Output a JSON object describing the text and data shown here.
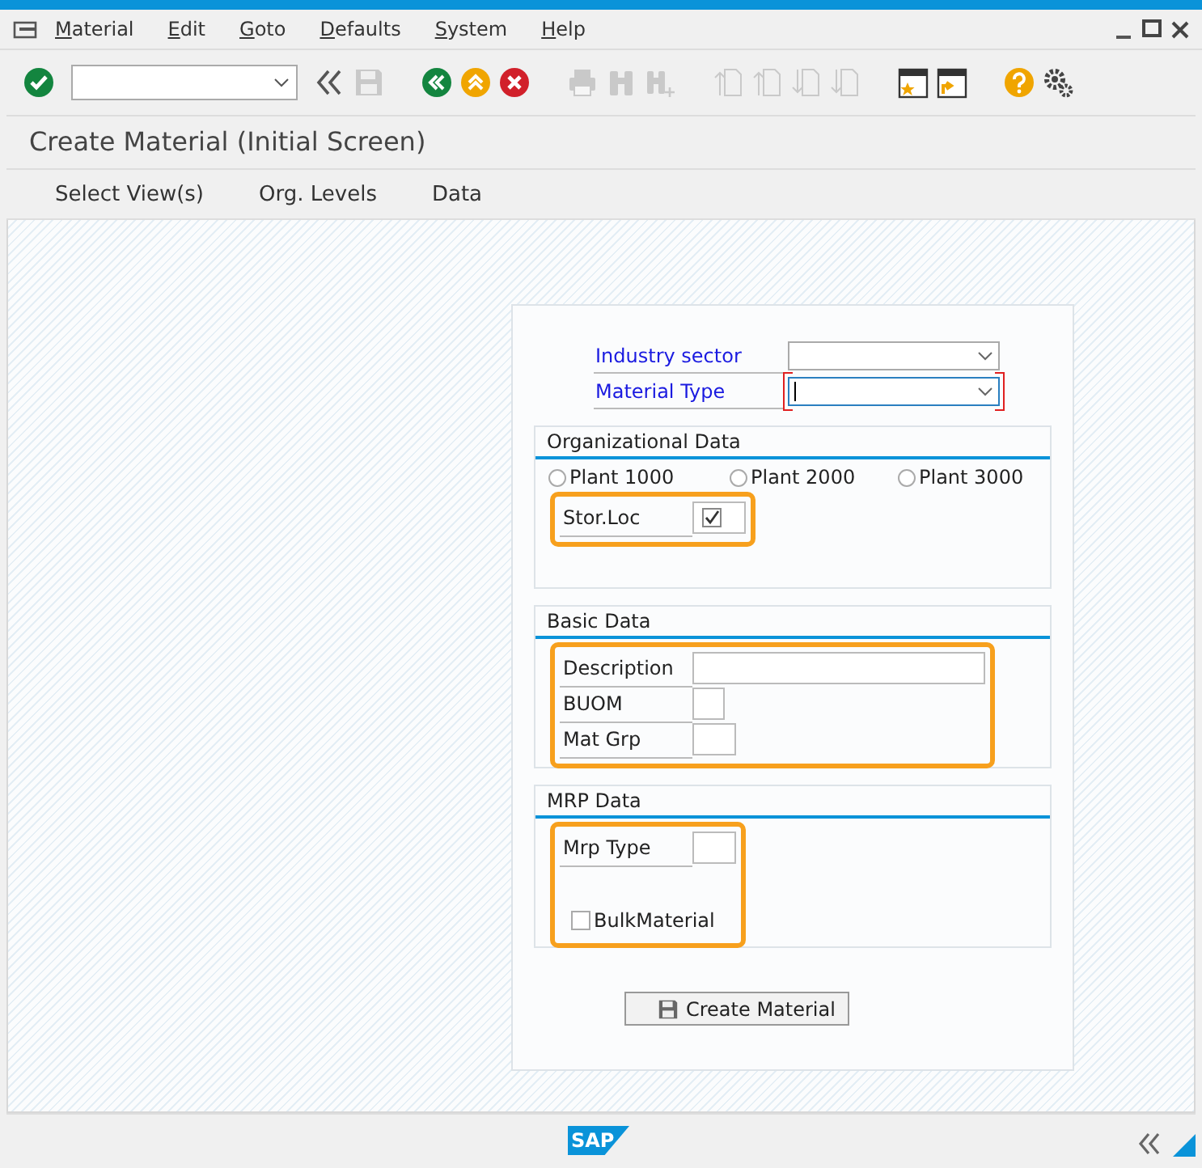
{
  "menu": [
    {
      "label": "Material"
    },
    {
      "label": "Edit"
    },
    {
      "label": "Goto"
    },
    {
      "label": "Defaults"
    },
    {
      "label": "System"
    },
    {
      "label": "Help"
    }
  ],
  "toolbar": {
    "icons": [
      {
        "kind": "enter",
        "disabled": false
      },
      {
        "kind": "command"
      },
      {
        "kind": "collapse",
        "disabled": false
      },
      {
        "kind": "save",
        "disabled": true
      },
      {
        "kind": "gap"
      },
      {
        "kind": "back",
        "disabled": false
      },
      {
        "kind": "exit",
        "disabled": false
      },
      {
        "kind": "cancel",
        "disabled": false
      },
      {
        "kind": "gap"
      },
      {
        "kind": "print",
        "disabled": true
      },
      {
        "kind": "find",
        "disabled": true
      },
      {
        "kind": "find-next",
        "disabled": true
      },
      {
        "kind": "gap"
      },
      {
        "kind": "first-page",
        "disabled": true
      },
      {
        "kind": "prev-page",
        "disabled": true
      },
      {
        "kind": "next-page",
        "disabled": true
      },
      {
        "kind": "last-page",
        "disabled": true
      },
      {
        "kind": "gap"
      },
      {
        "kind": "new-session",
        "disabled": false
      },
      {
        "kind": "shortcut",
        "disabled": false
      },
      {
        "kind": "gap"
      },
      {
        "kind": "help",
        "disabled": false
      },
      {
        "kind": "settings",
        "disabled": false
      }
    ]
  },
  "title": "Create Material (Initial Screen)",
  "app_toolbar": [
    {
      "label": "Select View(s)"
    },
    {
      "label": "Org. Levels"
    },
    {
      "label": "Data"
    }
  ],
  "header_fields": [
    {
      "label": "Industry sector",
      "focused": false,
      "required": false
    },
    {
      "label": "Material Type",
      "focused": true,
      "required": true
    }
  ],
  "groups": [
    {
      "title": "Organizational Data",
      "radios": [
        {
          "label": "Plant 1000",
          "selected": false
        },
        {
          "label": "Plant 2000",
          "selected": false
        },
        {
          "label": "Plant 3000",
          "selected": false
        }
      ],
      "highlighted": true,
      "rows": [
        {
          "kind": "checkfield",
          "label": "Stor.Loc",
          "checked": true
        }
      ]
    },
    {
      "title": "Basic Data",
      "highlighted": true,
      "rows": [
        {
          "kind": "widefield",
          "label": "Description"
        },
        {
          "kind": "tinyfield",
          "label": "BUOM"
        },
        {
          "kind": "field",
          "label": "Mat Grp"
        }
      ]
    },
    {
      "title": "MRP Data",
      "highlighted": true,
      "rows": [
        {
          "kind": "field",
          "label": "Mrp Type"
        },
        {
          "kind": "spacer"
        },
        {
          "kind": "checkbox",
          "label": "BulkMaterial",
          "checked": false
        }
      ]
    }
  ],
  "action_button": {
    "label": "Create Material"
  },
  "footer": {
    "logo": "SAP"
  }
}
